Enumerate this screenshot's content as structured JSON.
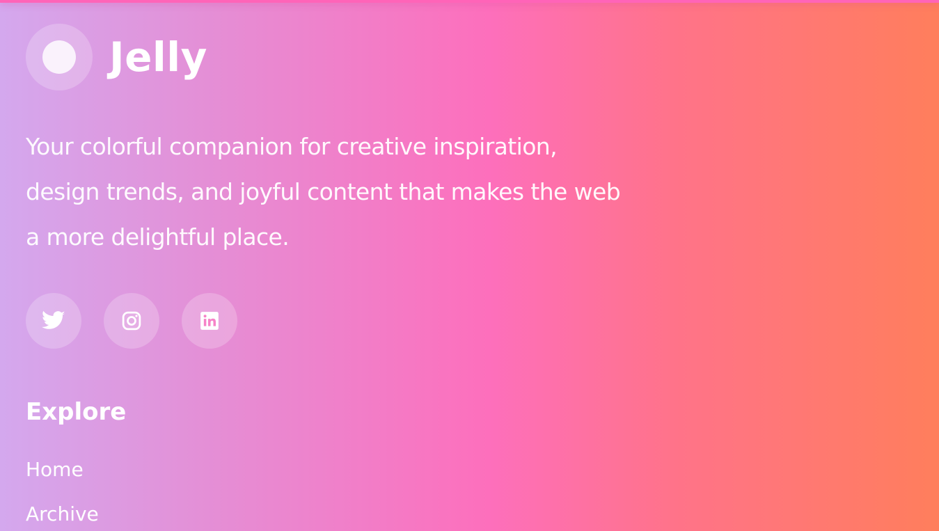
{
  "brand": {
    "name": "Jelly",
    "logo_icon": "jelly-circle-logo"
  },
  "tagline": "Your colorful companion for creative inspiration, design trends, and joyful content that makes the web a more delightful place.",
  "social": [
    {
      "name": "Twitter",
      "icon": "twitter-icon"
    },
    {
      "name": "Instagram",
      "icon": "instagram-icon"
    },
    {
      "name": "LinkedIn",
      "icon": "linkedin-icon"
    }
  ],
  "explore": {
    "heading": "Explore",
    "links": [
      "Home",
      "Archive"
    ]
  },
  "colors": {
    "gradient_start": "#d4a8ee",
    "gradient_mid": "#fd6fbc",
    "gradient_end": "#ff7e5c",
    "top_strip": "#ff64b8",
    "text": "#ffffff"
  }
}
